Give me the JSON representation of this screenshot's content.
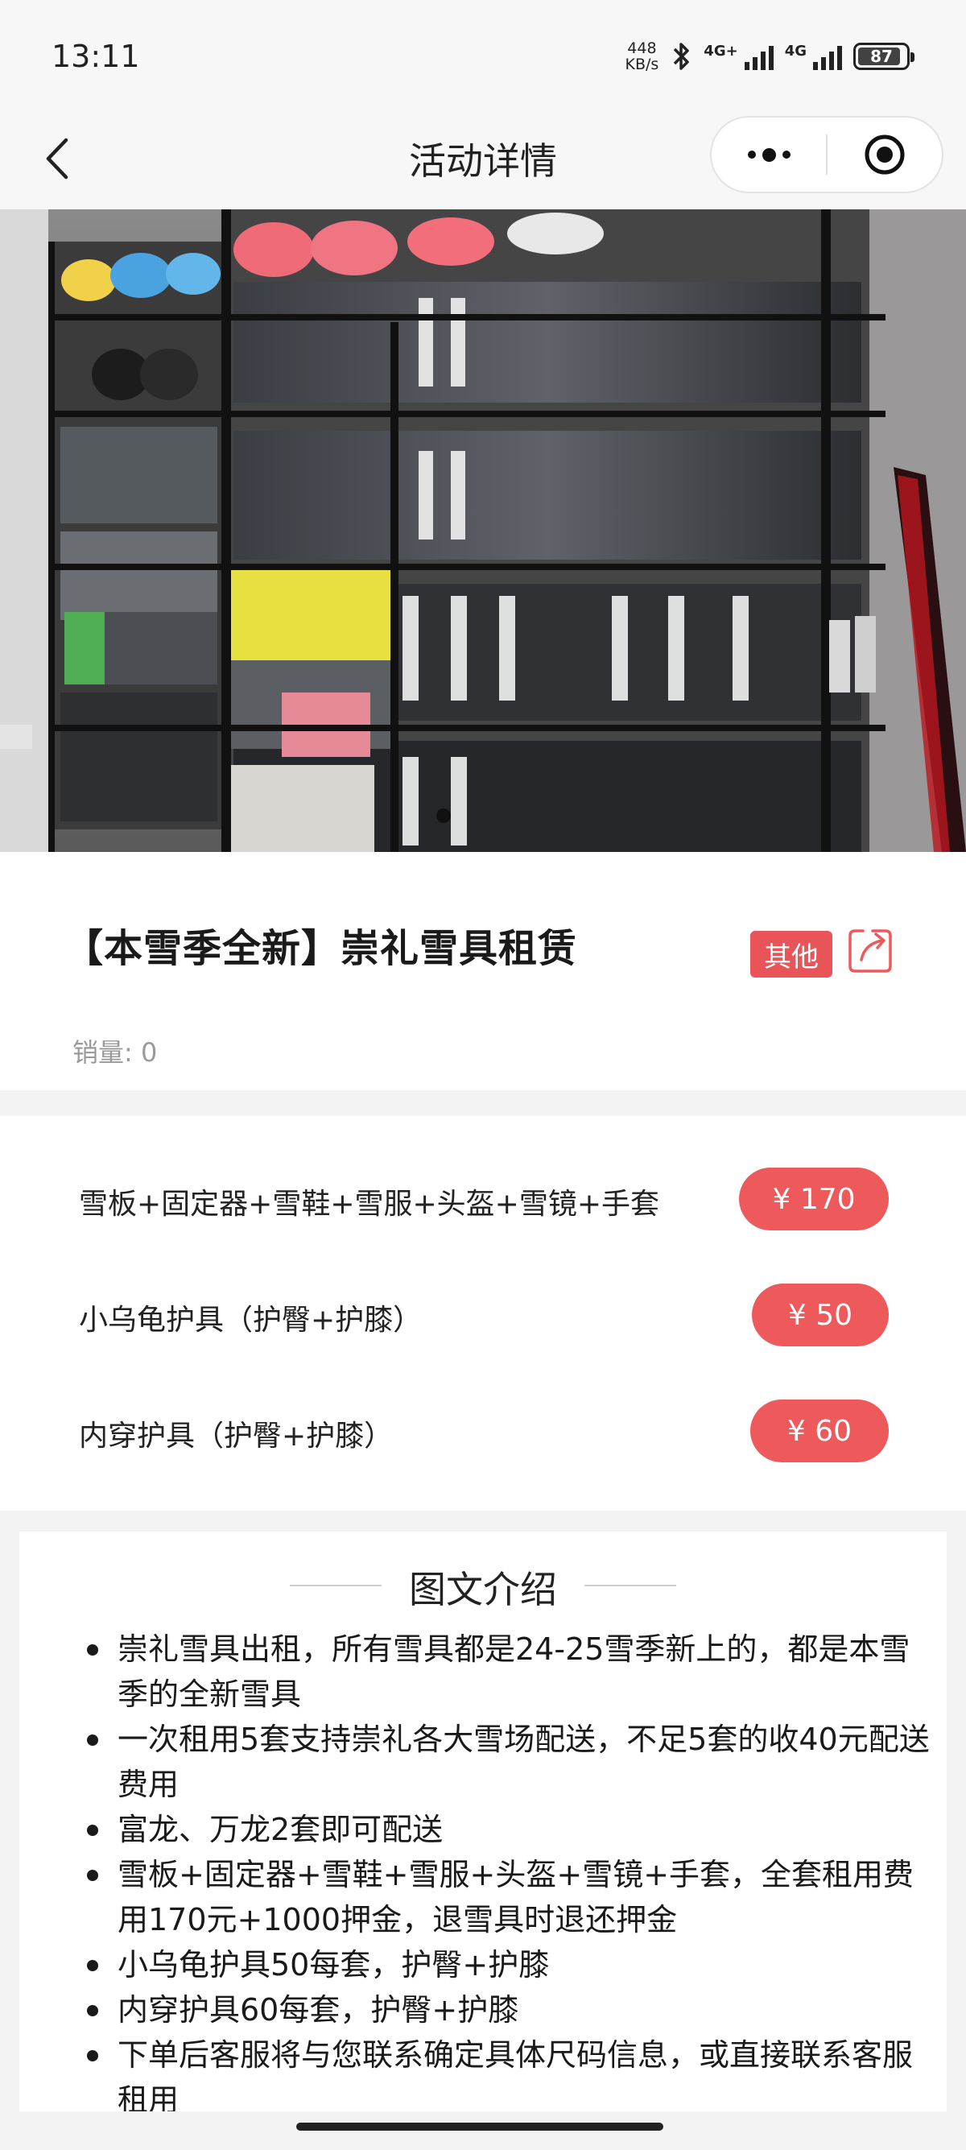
{
  "status_bar": {
    "time": "13:11",
    "net_speed_value": "448",
    "net_speed_unit": "KB/s",
    "network1": "4G+",
    "network2": "4G",
    "battery": "87"
  },
  "nav": {
    "title": "活动详情"
  },
  "banner": {
    "image_alt": "store shelves with snowboard boots, helmets and protective gear",
    "page_indicator_count": 1
  },
  "product": {
    "title": "【本雪季全新】崇礼雪具租赁",
    "category": "其他",
    "sales": "销量: 0"
  },
  "prices": [
    {
      "name": "雪板+固定器+雪鞋+雪服+头盔+雪镜+手套",
      "price": "¥ 170"
    },
    {
      "name": "小乌龟护具（护臀+护膝）",
      "price": "¥ 50"
    },
    {
      "name": "内穿护具（护臀+护膝）",
      "price": "¥ 60"
    }
  ],
  "intro": {
    "title": "图文介绍",
    "items": [
      "崇礼雪具出租，所有雪具都是24-25雪季新上的，都是本雪季的全新雪具",
      "一次租用5套支持崇礼各大雪场配送，不足5套的收40元配送费用",
      "富龙、万龙2套即可配送",
      "雪板+固定器+雪鞋+雪服+头盔+雪镜+手套，全套租用费用170元+1000押金，退雪具时退还押金",
      "小乌龟护具50每套，护臀+护膝",
      "内穿护具60每套，护臀+护膝",
      "下单后客服将与您联系确定具体尺码信息，或直接联系客服租用"
    ]
  },
  "colors": {
    "accent": "#ee5a5c",
    "badge": "#e85457",
    "background": "#f3f3f3"
  }
}
